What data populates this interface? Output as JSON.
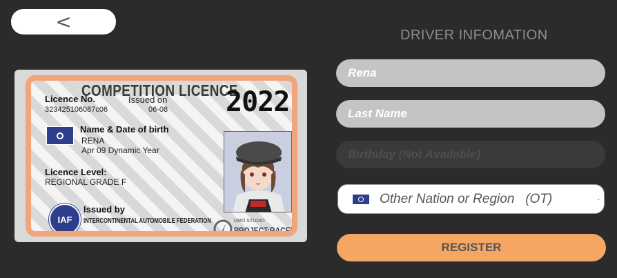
{
  "back_button": {
    "label": "<"
  },
  "licence": {
    "title": "COMPETITION LICENCE",
    "year": "2022",
    "licence_no_label": "Licence No.",
    "licence_no": "323425106087c06",
    "issued_on_label": "Issued on",
    "issued_on": "06-08",
    "name_dob_label": "Name & Date of birth",
    "name": "RENA",
    "dob": "Apr 09 Dynamic Year",
    "level_label": "Licence Level:",
    "level": "REGIONAL GRADE F",
    "issued_by_label": "Issued by",
    "issuer": "INTERCONTINENTAL AUTOMOBILE FEDERATION",
    "issuer_logo_text": "IAF",
    "studio_small": "UMO STUDIO",
    "studio_name": "PROJECT:RACER"
  },
  "form": {
    "title": "DRIVER INFOMATION",
    "first_name_value": "Rena",
    "last_name_placeholder": "Last Name",
    "birthday_placeholder": "Birthday (Not Available)",
    "nation_value": "Other Nation or Region   (OT)",
    "register_label": "REGISTER"
  },
  "colors": {
    "accent": "#f5a662",
    "card_border": "#f0a57a",
    "flag_blue": "#2c3e8c"
  }
}
